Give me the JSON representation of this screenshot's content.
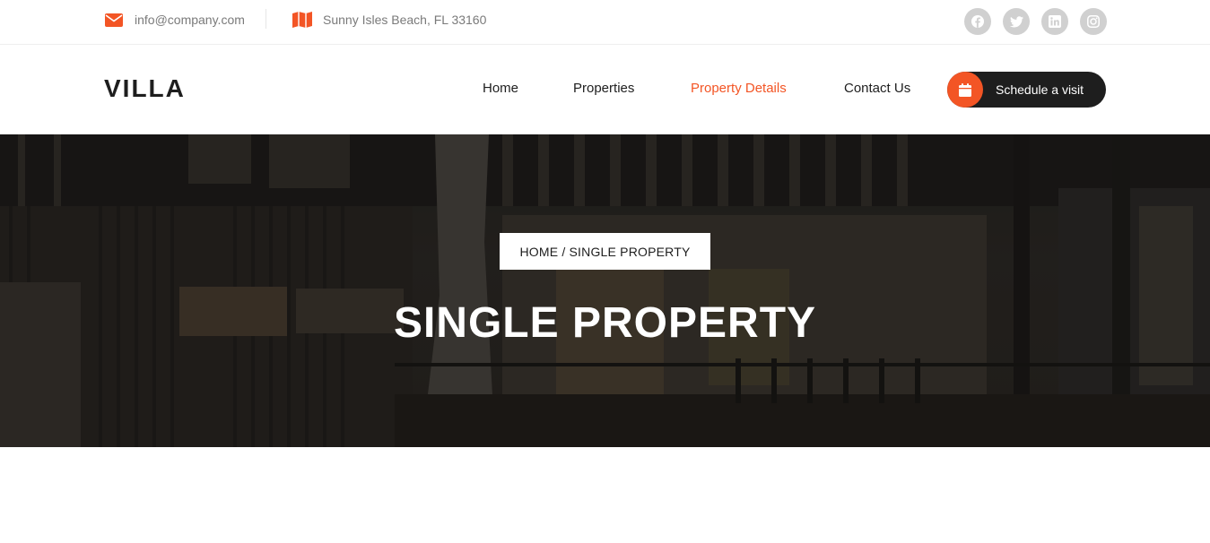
{
  "topbar": {
    "email": "info@company.com",
    "address": "Sunny Isles Beach, FL 33160",
    "socials": [
      "facebook-icon",
      "twitter-icon",
      "linkedin-icon",
      "instagram-icon"
    ]
  },
  "header": {
    "logo": "VILLA",
    "nav": [
      {
        "label": "Home",
        "active": false
      },
      {
        "label": "Properties",
        "active": false
      },
      {
        "label": "Property Details",
        "active": true
      },
      {
        "label": "Contact Us",
        "active": false
      }
    ],
    "cta_label": "Schedule a visit"
  },
  "hero": {
    "breadcrumb": "HOME / SINGLE PROPERTY",
    "title": "SINGLE PROPERTY"
  },
  "colors": {
    "accent": "#f35525",
    "dark": "#1e1e1e",
    "muted": "#7a7a7a",
    "social_bg": "#d0d0d0"
  }
}
